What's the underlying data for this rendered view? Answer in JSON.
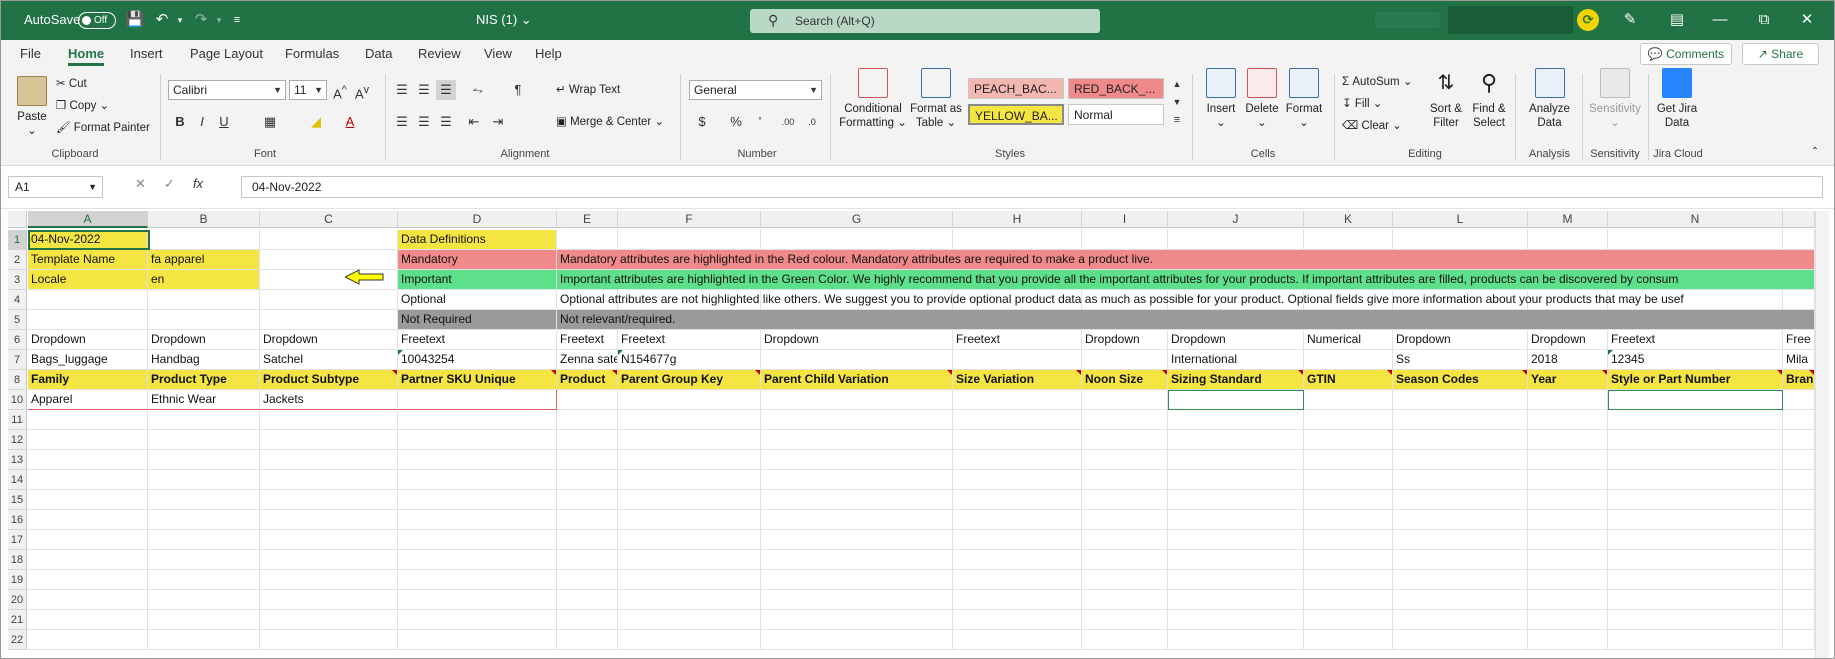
{
  "titlebar": {
    "autosave_label": "AutoSave",
    "autosave_state": "Off",
    "doc_title": "NIS (1)",
    "search_placeholder": "Search (Alt+Q)"
  },
  "tabs": [
    "File",
    "Home",
    "Insert",
    "Page Layout",
    "Formulas",
    "Data",
    "Review",
    "View",
    "Help"
  ],
  "active_tab": "Home",
  "tab_right": {
    "comments": "Comments",
    "share": "Share"
  },
  "ribbon": {
    "clipboard": {
      "paste": "Paste",
      "cut": "Cut",
      "copy": "Copy",
      "format_painter": "Format Painter",
      "label": "Clipboard"
    },
    "font": {
      "name": "Calibri",
      "size": "11",
      "label": "Font"
    },
    "alignment": {
      "wrap": "Wrap Text",
      "merge": "Merge & Center",
      "label": "Alignment"
    },
    "number": {
      "format": "General",
      "label": "Number"
    },
    "styles": {
      "conditional": "Conditional Formatting",
      "format_table": "Format as Table",
      "cells": [
        "PEACH_BAC...",
        "RED_BACK_...",
        "YELLOW_BA...",
        "Normal"
      ],
      "label": "Styles"
    },
    "cells": {
      "insert": "Insert",
      "delete": "Delete",
      "format": "Format",
      "label": "Cells"
    },
    "editing": {
      "autosum": "AutoSum",
      "fill": "Fill",
      "clear": "Clear",
      "sort": "Sort & Filter",
      "find": "Find & Select",
      "label": "Editing"
    },
    "analysis": {
      "analyze": "Analyze Data",
      "label": "Analysis"
    },
    "sensitivity": {
      "btn": "Sensitivity",
      "label": "Sensitivity"
    },
    "jira": {
      "btn": "Get Jira Data",
      "label": "Jira Cloud"
    }
  },
  "formula_bar": {
    "name_box": "A1",
    "fx": "fx",
    "value": "04-Nov-2022"
  },
  "columns": [
    "A",
    "B",
    "C",
    "D",
    "E",
    "F",
    "G",
    "H",
    "I",
    "J",
    "K",
    "L",
    "M",
    "N",
    ""
  ],
  "rows": [
    "1",
    "2",
    "3",
    "4",
    "5",
    "6",
    "7",
    "8",
    "10",
    "11",
    "12",
    "13",
    "14",
    "15",
    "16",
    "17",
    "18",
    "19",
    "20",
    "21",
    "22"
  ],
  "sheet": {
    "a1": "04-Nov-2022",
    "a2": "Template Name",
    "b2": "fa apparel",
    "a3": "Locale",
    "b3": "en",
    "d1": "Data Definitions",
    "d2": "Mandatory",
    "e2": "Mandatory attributes are highlighted in the Red colour. Mandatory attributes are required to make a product live.",
    "d3": "Important",
    "e3": "Important attributes are highlighted in the Green Color. We highly recommend that you provide all the important attributes for your products. If important attributes are filled, products can be discovered by consum",
    "d4": "Optional",
    "e4": "Optional attributes are not highlighted like others. We suggest you to provide optional product data as much as possible for your product. Optional fields give more information about your products that may be usef",
    "d5": "Not Required",
    "e5": "Not relevant/required.",
    "row6": [
      "Dropdown",
      "Dropdown",
      "Dropdown",
      "Freetext",
      "Freetext",
      "Freetext",
      "Dropdown",
      "Freetext",
      "Dropdown",
      "Dropdown",
      "Numerical",
      "Dropdown",
      "Dropdown",
      "Freetext",
      "Free"
    ],
    "row7": [
      "Bags_luggage",
      "Handbag",
      "Satchel",
      "10043254",
      "Zenna sate",
      "N154677g",
      "",
      "",
      "",
      "International",
      "",
      "Ss",
      "2018",
      "12345",
      "Mila"
    ],
    "row8": [
      "Family",
      "Product Type",
      "Product Subtype",
      "Partner SKU Unique",
      "Product",
      "Parent Group Key",
      "Parent Child Variation",
      "Size Variation",
      "Noon Size",
      "Sizing Standard",
      "GTIN",
      "Season Codes",
      "Year",
      "Style or Part Number",
      "Bran"
    ],
    "row10": [
      "Apparel",
      "Ethnic Wear",
      "Jackets"
    ]
  }
}
